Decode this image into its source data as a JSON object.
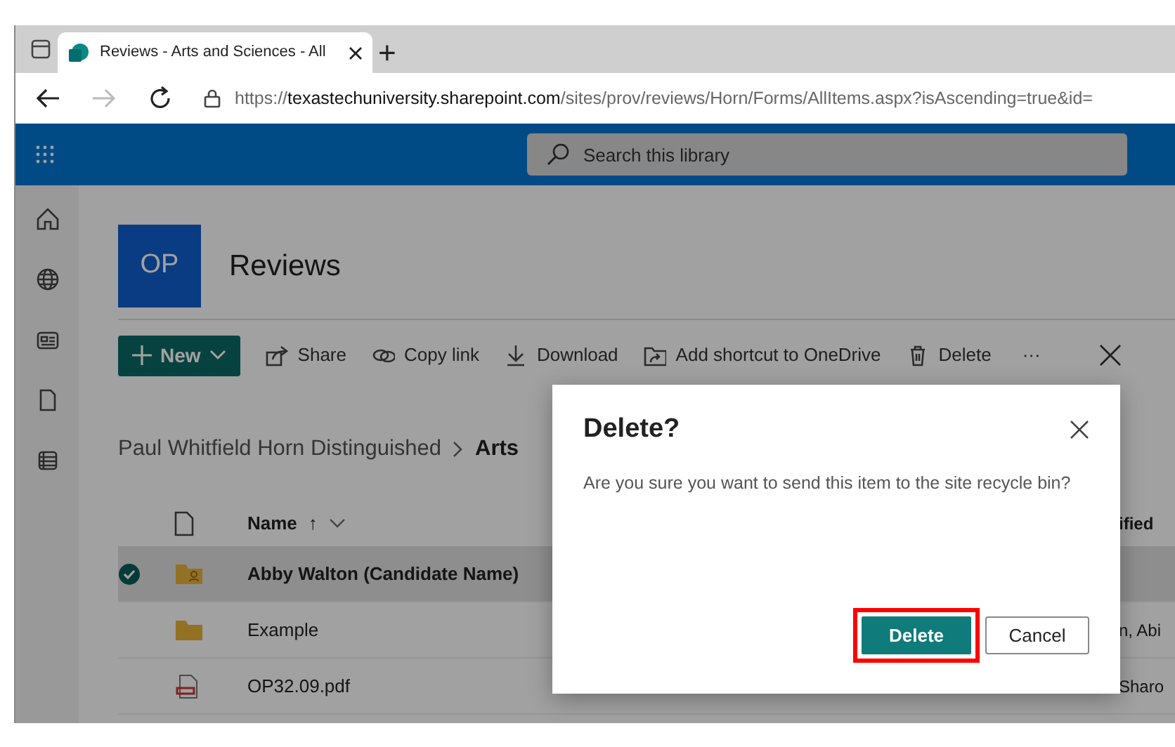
{
  "browser": {
    "tab": {
      "title": "Reviews - Arts and Sciences - All",
      "selected": true
    },
    "new_tab": "+",
    "url": {
      "scheme": "https://",
      "host": "texastechuniversity.sharepoint.com",
      "path": "/sites/prov/reviews/Horn/Forms/AllItems.aspx?isAscending=true&id="
    }
  },
  "search": {
    "placeholder": "Search this library"
  },
  "site": {
    "logo": "OP",
    "title": "Reviews"
  },
  "toolbar": {
    "new_button": "New",
    "commands": [
      {
        "label": "Share",
        "kind": "share"
      },
      {
        "label": "Copy link",
        "kind": "link"
      },
      {
        "label": "Download",
        "kind": "download"
      },
      {
        "label": "Add shortcut to OneDrive",
        "kind": "shortcut"
      },
      {
        "label": "Delete",
        "kind": "trash"
      },
      {
        "label": "···",
        "kind": "more"
      }
    ]
  },
  "breadcrumb": [
    "Paul Whitfield Horn Distinguished",
    "Arts"
  ],
  "list": {
    "columns": {
      "name": "Name",
      "sort": "↑",
      "column_2": "ified"
    },
    "rows": [
      {
        "name": "Abby Walton (Candidate Name)",
        "kind": "person-folder",
        "selected": true
      },
      {
        "name": "Example",
        "kind": "folder",
        "selected": false,
        "column_2": "n, Abi"
      },
      {
        "name": "OP32.09.pdf",
        "kind": "pdf",
        "selected": false,
        "column_2": "Sharo"
      }
    ]
  },
  "dialog": {
    "title": "Delete?",
    "message": "Are you sure you want to send this item to the site recycle bin?",
    "buttons": [
      {
        "label": "Delete",
        "kind": "primary",
        "highlighted": true
      },
      {
        "label": "Cancel",
        "kind": "secondary",
        "highlighted": false
      }
    ]
  }
}
